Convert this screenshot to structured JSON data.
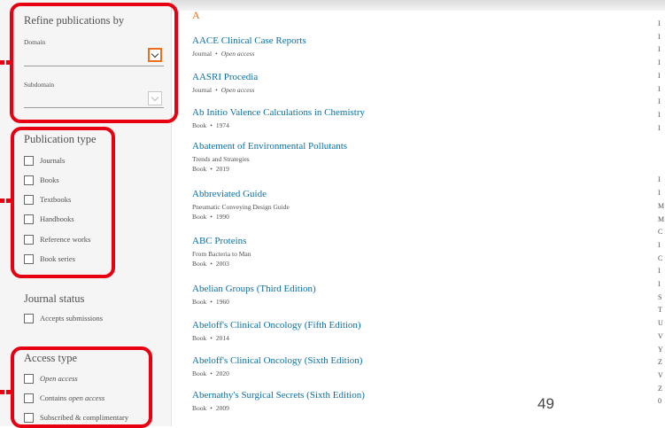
{
  "sidebar": {
    "refine_title": "Refine publications by",
    "domain_label": "Domain",
    "subdomain_label": "Subdomain",
    "publication_type_title": "Publication type",
    "publication_types": [
      "Journals",
      "Books",
      "Textbooks",
      "Handbooks",
      "Reference works",
      "Book series"
    ],
    "journal_status_title": "Journal status",
    "journal_status_options": [
      "Accepts submissions"
    ],
    "access_type_title": "Access type",
    "access_types": {
      "open_access": "Open access",
      "contains_prefix": "Contains ",
      "contains_em": "open access",
      "subscribed": "Subscribed & complimentary"
    }
  },
  "results": {
    "letter": "A",
    "sep": "•",
    "items": [
      {
        "title": "AACE Clinical Case Reports",
        "type": "Journal",
        "extra": "Open access"
      },
      {
        "title": "AASRI Procedia",
        "type": "Journal",
        "extra": "Open access"
      },
      {
        "title": "Ab Initio Valence Calculations in Chemistry",
        "type": "Book",
        "extra": "1974"
      },
      {
        "title": "Abatement of Environmental Pollutants",
        "subtitle": "Trends and Strategies",
        "type": "Book",
        "extra": "2019"
      },
      {
        "title": "Abbreviated Guide",
        "subtitle": "Pneumatic Conveying Design Guide",
        "type": "Book",
        "extra": "1990"
      },
      {
        "title": "ABC Proteins",
        "subtitle": "From Bacteria to Man",
        "type": "Book",
        "extra": "2003"
      },
      {
        "title": "Abelian Groups (Third Edition)",
        "type": "Book",
        "extra": "1960"
      },
      {
        "title": "Abeloff's Clinical Oncology (Fifth Edition)",
        "type": "Book",
        "extra": "2014"
      },
      {
        "title": "Abeloff's Clinical Oncology (Sixth Edition)",
        "type": "Book",
        "extra": "2020"
      },
      {
        "title": "Abernathy's Surgical Secrets (Sixth Edition)",
        "type": "Book",
        "extra": "2009"
      }
    ]
  },
  "page_number": "49",
  "right_edge_glyphs": [
    "I",
    "I",
    "I",
    "I",
    "I",
    "I",
    "I",
    "I",
    "I",
    "",
    "",
    "",
    "I",
    "I",
    "M",
    "M",
    "C",
    "I",
    "C",
    "I",
    "I",
    "S",
    "T",
    "U",
    "V",
    "Y",
    "Z",
    "V",
    "Z",
    "0"
  ],
  "colors": {
    "highlight": "#e60012",
    "link": "#0b6fa4",
    "accent": "#e9711c"
  }
}
